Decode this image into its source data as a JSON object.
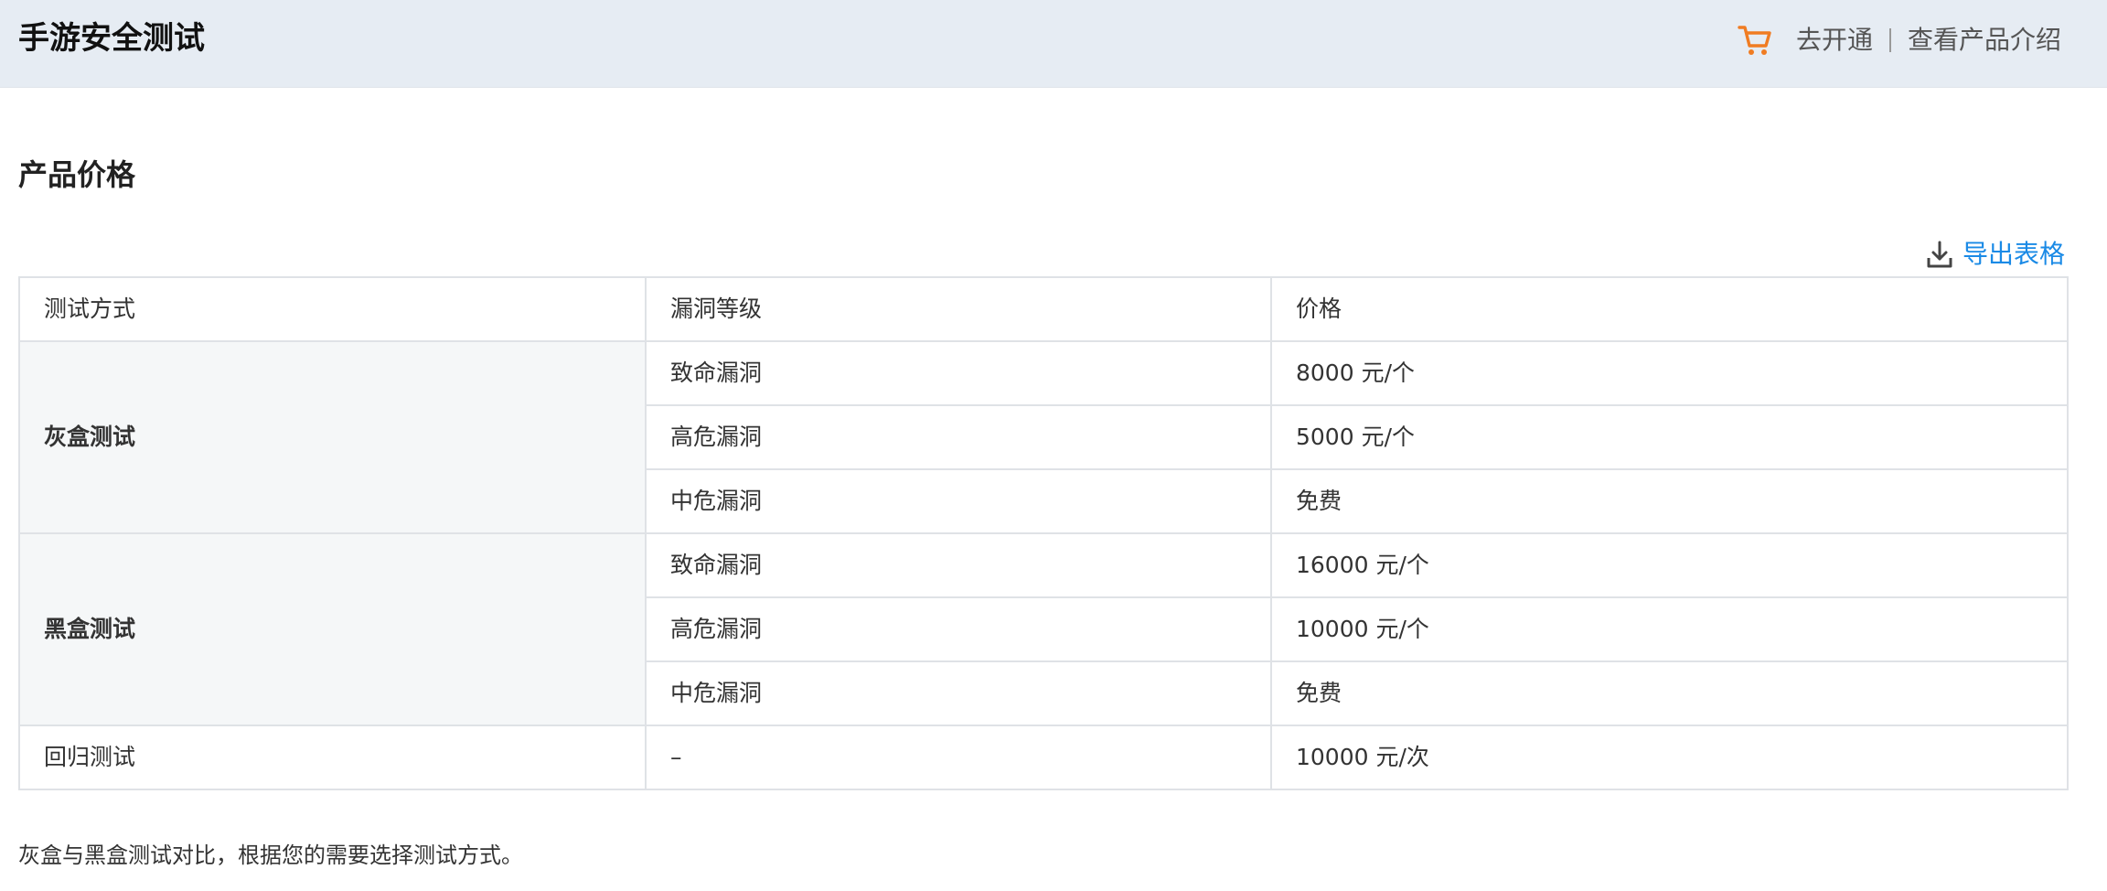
{
  "header": {
    "title": "手游安全测试",
    "cart_icon": "shopping-cart-icon",
    "accent_color": "#f07c22",
    "links": {
      "activate": "去开通",
      "product_intro": "查看产品介绍"
    }
  },
  "pricing": {
    "title": "产品价格",
    "export": {
      "icon": "download-icon",
      "label": "导出表格",
      "color": "#1a8ae6"
    },
    "table": {
      "columns": [
        "测试方式",
        "漏洞等级",
        "价格"
      ],
      "groups": [
        {
          "method": "灰盒测试",
          "rows": [
            {
              "level": "致命漏洞",
              "price": "8000 元/个"
            },
            {
              "level": "高危漏洞",
              "price": "5000 元/个"
            },
            {
              "level": "中危漏洞",
              "price": "免费"
            }
          ]
        },
        {
          "method": "黑盒测试",
          "rows": [
            {
              "level": "致命漏洞",
              "price": "16000 元/个"
            },
            {
              "level": "高危漏洞",
              "price": "10000 元/个"
            },
            {
              "level": "中危漏洞",
              "price": "免费"
            }
          ]
        },
        {
          "method": "回归测试",
          "rows": [
            {
              "level": "–",
              "price": "10000 元/次"
            }
          ]
        }
      ]
    }
  },
  "footnote": "灰盒与黑盒测试对比，根据您的需要选择测试方式。"
}
